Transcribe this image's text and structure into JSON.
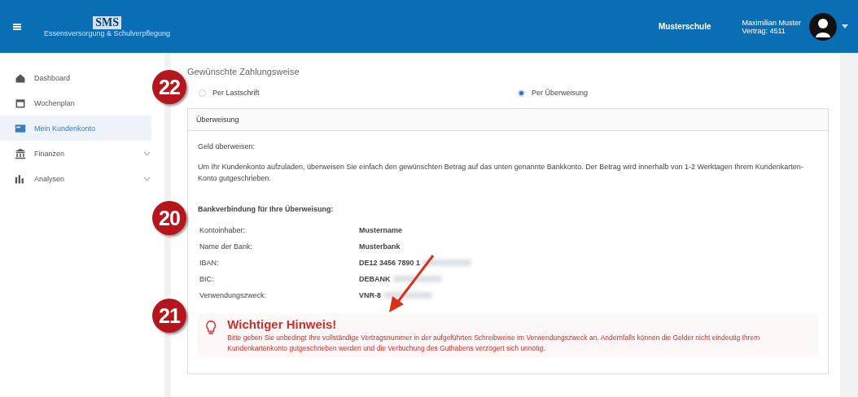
{
  "header": {
    "logo": "SMS",
    "logo_subtitle": "Essensversorgung & Schulverpflegung",
    "school": "Musterschule",
    "user_name": "Maximilian Muster",
    "contract": "Vertrag: 4511"
  },
  "sidebar": {
    "items": [
      {
        "label": "Dashboard",
        "kind": "home",
        "selected": false,
        "expandable": false
      },
      {
        "label": "Wochenplan",
        "kind": "calendar",
        "selected": false,
        "expandable": false
      },
      {
        "label": "Mein Kundenkonto",
        "kind": "card",
        "selected": true,
        "expandable": false
      },
      {
        "label": "Finanzen",
        "kind": "bank",
        "selected": false,
        "expandable": true
      },
      {
        "label": "Analysen",
        "kind": "chart",
        "selected": false,
        "expandable": true
      }
    ]
  },
  "payment": {
    "title": "Gewünschte Zahlungsweise",
    "options": [
      {
        "label": "Per Lastschrift",
        "selected": false
      },
      {
        "label": "Per Überweisung",
        "selected": true
      }
    ]
  },
  "card": {
    "title": "Überweisung",
    "subtitle": "Geld überweisen:",
    "text": "Um Ihr Kundenkonto aufzuladen, überweisen Sie einfach den gewünschten Betrag auf das unten genannte Bankkonto. Der Betrag wird innerhalb von 1-2 Werktagen Ihrem Kundenkarten-Konto gutgeschrieben.",
    "bank_title": "Bankverbindung für Ihre Überweisung:",
    "bank_rows": [
      {
        "label": "Kontoinhaber:",
        "value": "Mustername",
        "redacted": false
      },
      {
        "label": "Name der Bank:",
        "value": "Musterbank",
        "redacted": false
      },
      {
        "label": "IBAN:",
        "value": "DE12 3456 7890 1",
        "redacted": true
      },
      {
        "label": "BIC:",
        "value": "DEBANK",
        "redacted": true
      },
      {
        "label": "Verwendungszweck:",
        "value": "VNR-8",
        "redacted": true
      }
    ],
    "notice": {
      "title": "Wichtiger Hinweis!",
      "text": "Bitte geben Sie unbedingt Ihre vollständige Vertragsnummer in der aufgeführten Schreibweise im Verwendungszweck an. Andernfalls können die Gelder nicht eindeutig Ihrem Kundenkartenkonto gutgeschrieben werden und die Verbuchung des Guthabens verzögert sich unnötig."
    }
  },
  "callouts": [
    {
      "number": "22"
    },
    {
      "number": "20"
    },
    {
      "number": "21"
    }
  ]
}
